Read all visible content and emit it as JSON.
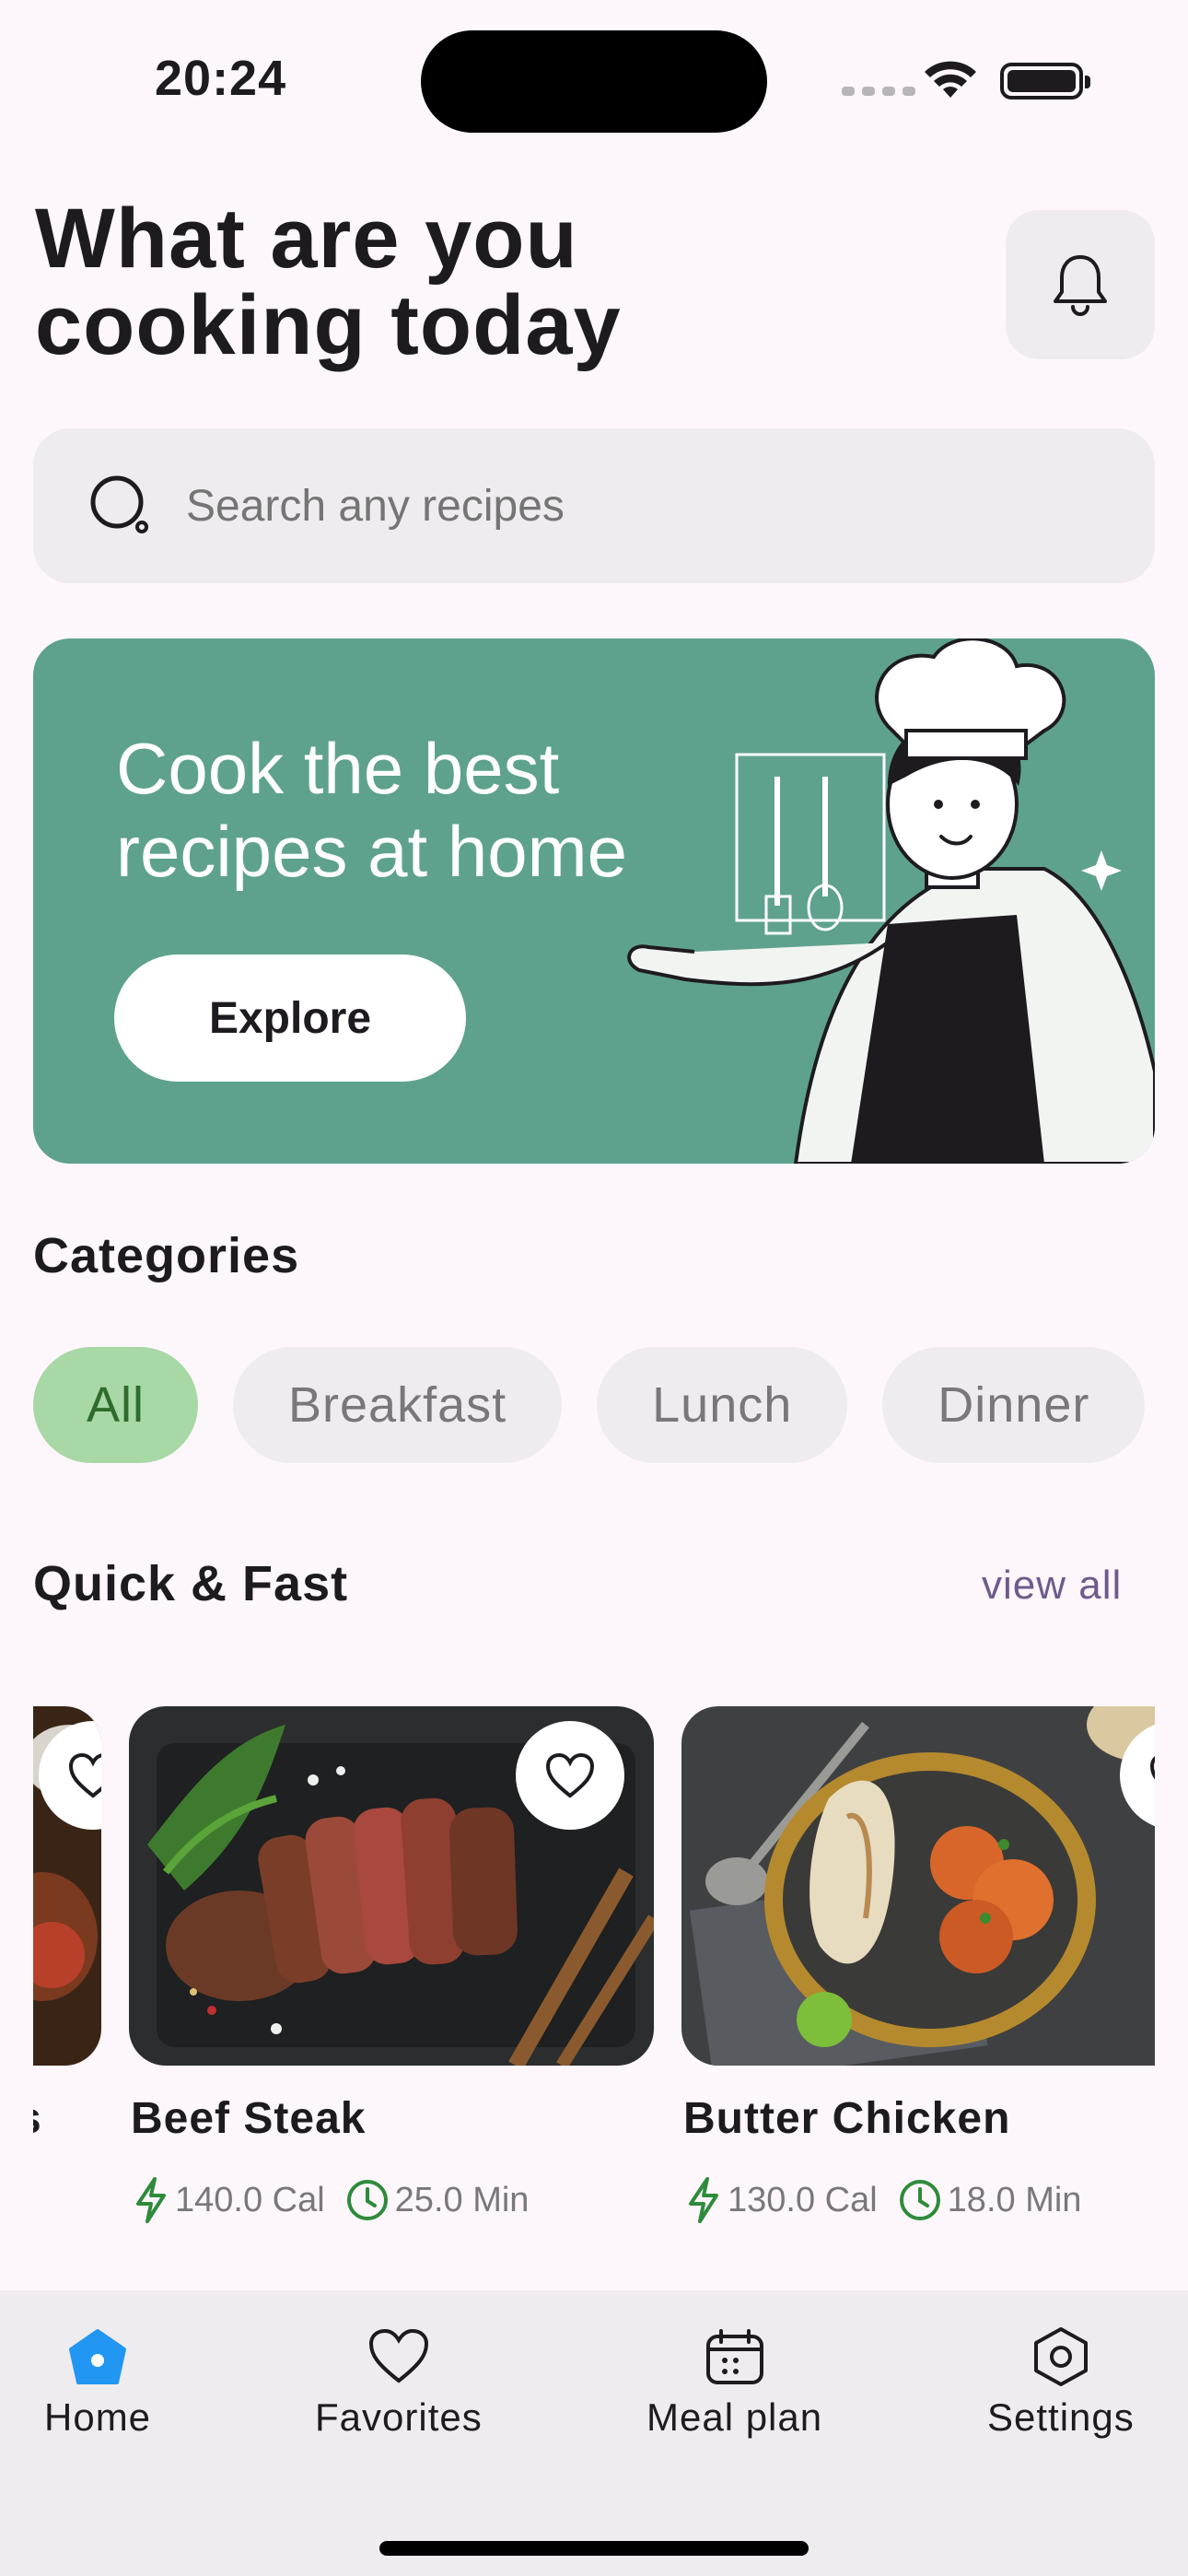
{
  "status_bar": {
    "time": "20:24"
  },
  "header": {
    "title": "What are you cooking today"
  },
  "search": {
    "placeholder": "Search any recipes"
  },
  "banner": {
    "headline": "Cook the best recipes at home",
    "button_label": "Explore"
  },
  "categories": {
    "title": "Categories",
    "items": [
      {
        "label": "All",
        "selected": true
      },
      {
        "label": "Breakfast",
        "selected": false
      },
      {
        "label": "Lunch",
        "selected": false
      },
      {
        "label": "Dinner",
        "selected": false
      }
    ]
  },
  "quick": {
    "title": "Quick & Fast",
    "view_all": "view all",
    "partial_card_name": "s",
    "cards": [
      {
        "name": "Beef Steak",
        "calories": "140.0 Cal",
        "time": "25.0 Min"
      },
      {
        "name": "Butter Chicken",
        "calories": "130.0 Cal",
        "time": "18.0 Min"
      }
    ]
  },
  "nav": {
    "items": [
      {
        "label": "Home",
        "icon": "home-icon",
        "active": true
      },
      {
        "label": "Favorites",
        "icon": "heart-icon",
        "active": false
      },
      {
        "label": "Meal plan",
        "icon": "calendar-icon",
        "active": false
      },
      {
        "label": "Settings",
        "icon": "settings-icon",
        "active": false
      }
    ]
  },
  "colors": {
    "background": "#FDF7FC",
    "banner": "#5EA28D",
    "chip_active": "#A8D8A6",
    "accent_green": "#2E8B3A",
    "nav_active": "#2196F3"
  }
}
